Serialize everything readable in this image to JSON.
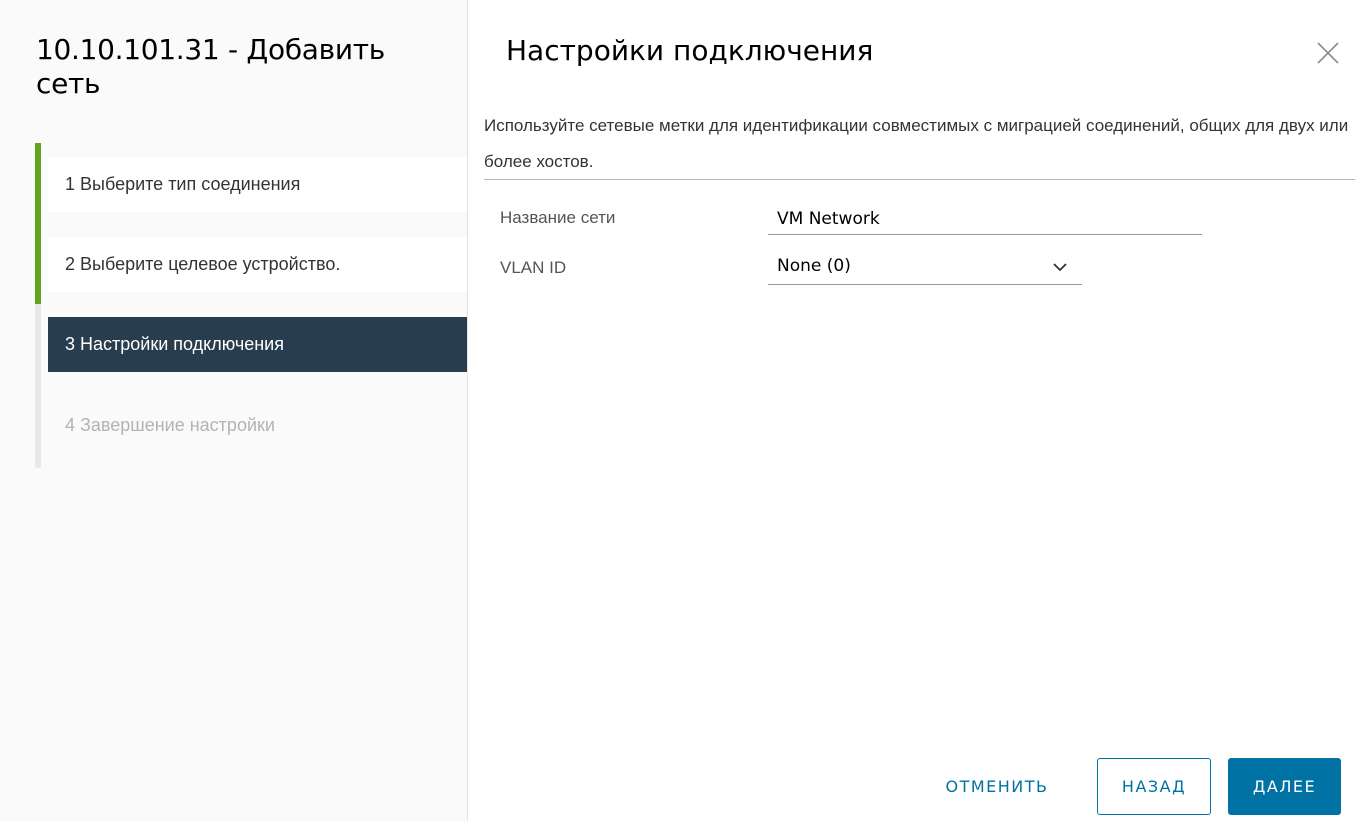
{
  "wizard": {
    "title": "10.10.101.31 - Добавить сеть",
    "steps": [
      {
        "label": "1 Выберите тип соединения",
        "state": "done"
      },
      {
        "label": "2 Выберите целевое устройство.",
        "state": "done"
      },
      {
        "label": "3 Настройки подключения",
        "state": "active"
      },
      {
        "label": "4 Завершение настройки",
        "state": "pending"
      }
    ]
  },
  "content": {
    "title": "Настройки подключения",
    "close_icon": "close-icon",
    "description": "Используйте сетевые метки для идентификации совместимых с миграцией соединений, общих для двух или более хостов.",
    "fields": {
      "network_name": {
        "label": "Название сети",
        "value": "VM Network"
      },
      "vlan_id": {
        "label": "VLAN ID",
        "value": "None (0)"
      }
    }
  },
  "footer": {
    "cancel_label": "ОТМЕНИТЬ",
    "back_label": "НАЗАД",
    "next_label": "ДАЛЕЕ"
  },
  "colors": {
    "accent": "#0072a3",
    "active_step": "#283d4e",
    "step_complete": "#62a420"
  }
}
